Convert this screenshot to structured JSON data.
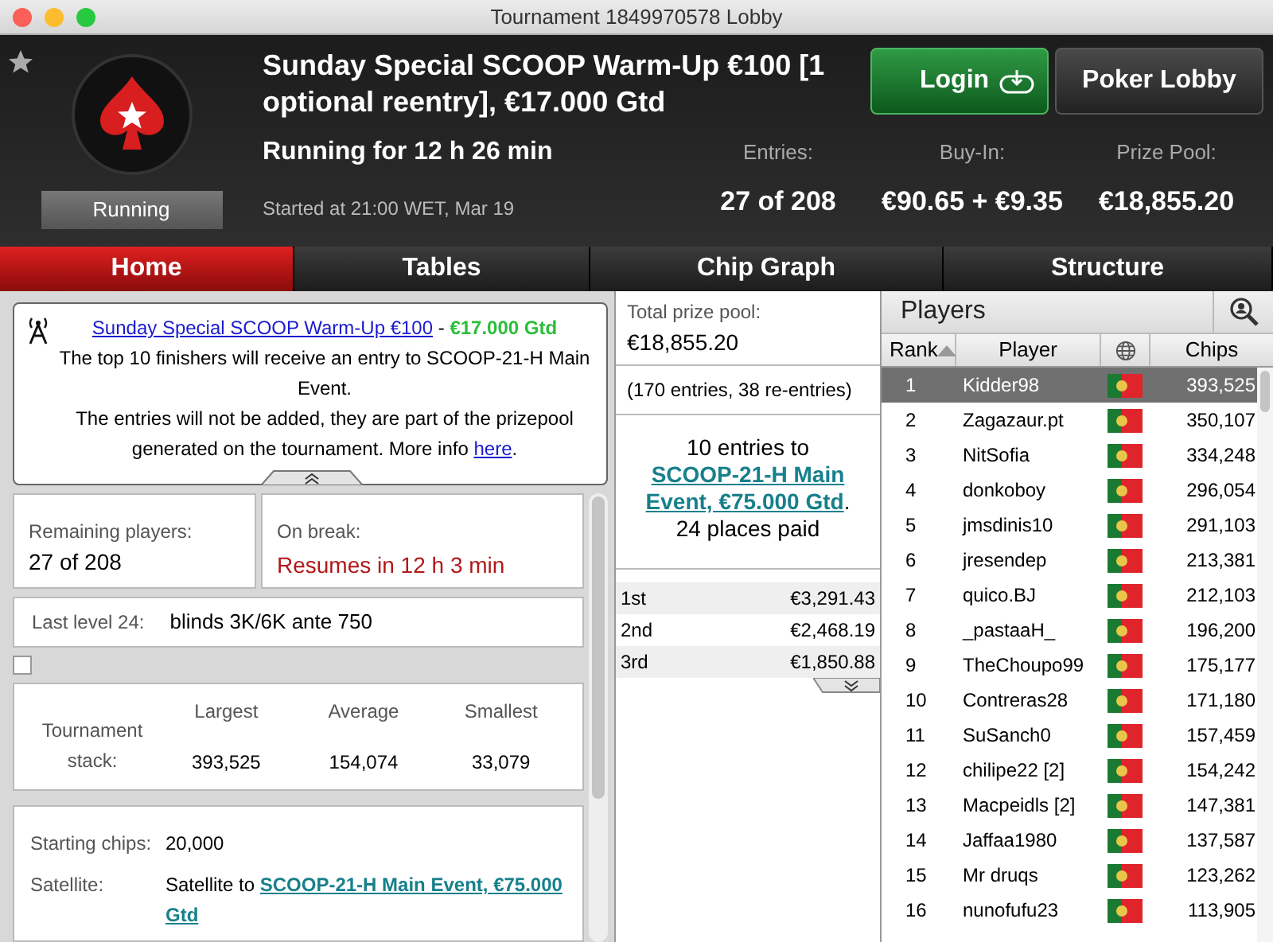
{
  "window": {
    "title": "Tournament 1849970578 Lobby"
  },
  "header": {
    "title": "Sunday Special SCOOP Warm-Up €100 [1 optional reentry], €17.000 Gtd",
    "status": "Running",
    "running_for": "Running for 12 h 26 min",
    "started": "Started at 21:00 WET, Mar 19",
    "stats": [
      {
        "label": "Entries:",
        "value": "27 of 208"
      },
      {
        "label": "Buy-In:",
        "value": "€90.65 + €9.35"
      },
      {
        "label": "Prize Pool:",
        "value": "€18,855.20"
      }
    ],
    "buttons": [
      {
        "label": "Login",
        "kind": "login"
      },
      {
        "label": "Poker Lobby",
        "kind": "plain"
      }
    ]
  },
  "tabs": [
    {
      "label": "Home",
      "selected": true
    },
    {
      "label": "Tables",
      "selected": false
    },
    {
      "label": "Chip Graph",
      "selected": false
    },
    {
      "label": "Structure",
      "selected": false
    }
  ],
  "info": {
    "title_link": "Sunday Special SCOOP Warm-Up €100",
    "separator": " - ",
    "guarantee": "€17.000 Gtd",
    "line1": "The top 10 finishers will receive an entry to SCOOP-21-H Main Event.",
    "line2": "The entries will not be added, they are part of the prizepool generated on the tournament. More info ",
    "link": "here",
    "line2_end": "."
  },
  "remaining": {
    "label": "Remaining players:",
    "value": "27 of 208"
  },
  "break": {
    "label": "On break:",
    "value": "Resumes in 12 h 3 min"
  },
  "level": {
    "label": "Last level 24:",
    "value": "blinds 3K/6K ante 750"
  },
  "checkbox": {
    "checked": false
  },
  "stack": {
    "label": "Tournament stack:",
    "columns": [
      {
        "label": "Largest",
        "value": "393,525"
      },
      {
        "label": "Average",
        "value": "154,074"
      },
      {
        "label": "Smallest",
        "value": "33,079"
      }
    ]
  },
  "details": {
    "starting_label": "Starting chips:",
    "starting_value": "20,000",
    "satellite_label": "Satellite:",
    "satellite_prefix": "Satellite to ",
    "satellite_link_lines": [
      "SCOOP-21-H Main Event, €75.000",
      "Gtd"
    ]
  },
  "prize": {
    "label": "Total prize pool:",
    "value": "€18,855.20",
    "entries": "(170 entries, 38 re-entries)",
    "seats_prefix": "10 entries to",
    "seats_link_lines": [
      "SCOOP-21-H Main",
      "Event, €75.000 Gtd"
    ],
    "seats_end": ".",
    "paid": "24 places paid",
    "places": [
      {
        "place": "1st",
        "amount": "€3,291.43"
      },
      {
        "place": "2nd",
        "amount": "€2,468.19"
      },
      {
        "place": "3rd",
        "amount": "€1,850.88"
      }
    ]
  },
  "players": {
    "title": "Players",
    "columns": [
      "Rank",
      "Player",
      "Chips"
    ],
    "rows": [
      {
        "rank": "1",
        "name": "Kidder98",
        "chips": "393,525",
        "selected": true
      },
      {
        "rank": "2",
        "name": "Zagazaur.pt",
        "chips": "350,107",
        "selected": false
      },
      {
        "rank": "3",
        "name": "NitSofia",
        "chips": "334,248",
        "selected": false
      },
      {
        "rank": "4",
        "name": "donkoboy",
        "chips": "296,054",
        "selected": false
      },
      {
        "rank": "5",
        "name": "jmsdinis10",
        "chips": "291,103",
        "selected": false
      },
      {
        "rank": "6",
        "name": "jresendep",
        "chips": "213,381",
        "selected": false
      },
      {
        "rank": "7",
        "name": "quico.BJ",
        "chips": "212,103",
        "selected": false
      },
      {
        "rank": "8",
        "name": "_pastaaH_",
        "chips": "196,200",
        "selected": false
      },
      {
        "rank": "9",
        "name": "TheChoupo99",
        "chips": "175,177",
        "selected": false
      },
      {
        "rank": "10",
        "name": "Contreras28",
        "chips": "171,180",
        "selected": false
      },
      {
        "rank": "11",
        "name": "SuSanch0",
        "chips": "157,459",
        "selected": false
      },
      {
        "rank": "12",
        "name": "chilipe22 [2]",
        "chips": "154,242",
        "selected": false
      },
      {
        "rank": "13",
        "name": "Macpeidls [2]",
        "chips": "147,381",
        "selected": false
      },
      {
        "rank": "14",
        "name": "Jaffaa1980",
        "chips": "137,587",
        "selected": false
      },
      {
        "rank": "15",
        "name": "Mr druqs",
        "chips": "123,262",
        "selected": false
      },
      {
        "rank": "16",
        "name": "nunofufu23",
        "chips": "113,905",
        "selected": false
      }
    ]
  }
}
